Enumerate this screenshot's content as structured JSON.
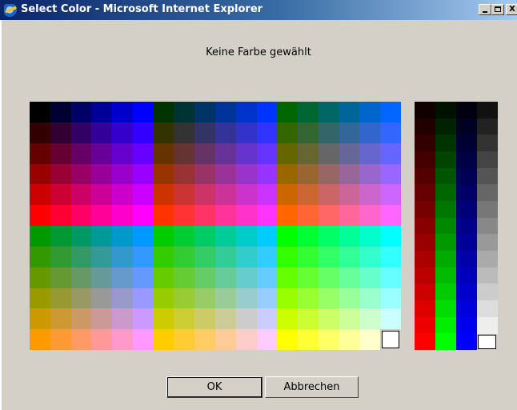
{
  "window": {
    "title": "Select Color - Microsoft Internet Explorer",
    "minimize_icon": "minimize-icon",
    "maximize_icon": "maximize-icon",
    "close_label": "X"
  },
  "status_text": "Keine Farbe gewählt",
  "palette": {
    "selected_color": "#ffffff",
    "rows": [
      [
        "#000000",
        "#000033",
        "#000066",
        "#000099",
        "#0000cc",
        "#0000ff",
        "#003300",
        "#003333",
        "#003366",
        "#003399",
        "#0033cc",
        "#0033ff",
        "#006600",
        "#006633",
        "#006666",
        "#006699",
        "#0066cc",
        "#0066ff"
      ],
      [
        "#330000",
        "#330033",
        "#330066",
        "#330099",
        "#3300cc",
        "#3300ff",
        "#333300",
        "#333333",
        "#333366",
        "#333399",
        "#3333cc",
        "#3333ff",
        "#336600",
        "#336633",
        "#336666",
        "#336699",
        "#3366cc",
        "#3366ff"
      ],
      [
        "#660000",
        "#660033",
        "#660066",
        "#660099",
        "#6600cc",
        "#6600ff",
        "#663300",
        "#663333",
        "#663366",
        "#663399",
        "#6633cc",
        "#6633ff",
        "#666600",
        "#666633",
        "#666666",
        "#666699",
        "#6666cc",
        "#6666ff"
      ],
      [
        "#990000",
        "#990033",
        "#990066",
        "#990099",
        "#9900cc",
        "#9900ff",
        "#993300",
        "#993333",
        "#993366",
        "#993399",
        "#9933cc",
        "#9933ff",
        "#996600",
        "#996633",
        "#996666",
        "#996699",
        "#9966cc",
        "#9966ff"
      ],
      [
        "#cc0000",
        "#cc0033",
        "#cc0066",
        "#cc0099",
        "#cc00cc",
        "#cc00ff",
        "#cc3300",
        "#cc3333",
        "#cc3366",
        "#cc3399",
        "#cc33cc",
        "#cc33ff",
        "#cc6600",
        "#cc6633",
        "#cc6666",
        "#cc6699",
        "#cc66cc",
        "#cc66ff"
      ],
      [
        "#ff0000",
        "#ff0033",
        "#ff0066",
        "#ff0099",
        "#ff00cc",
        "#ff00ff",
        "#ff3300",
        "#ff3333",
        "#ff3366",
        "#ff3399",
        "#ff33cc",
        "#ff33ff",
        "#ff6600",
        "#ff6633",
        "#ff6666",
        "#ff6699",
        "#ff66cc",
        "#ff66ff"
      ],
      [
        "#009900",
        "#009933",
        "#009966",
        "#009999",
        "#0099cc",
        "#0099ff",
        "#00cc00",
        "#00cc33",
        "#00cc66",
        "#00cc99",
        "#00cccc",
        "#00ccff",
        "#00ff00",
        "#00ff33",
        "#00ff66",
        "#00ff99",
        "#00ffcc",
        "#00ffff"
      ],
      [
        "#339900",
        "#339933",
        "#339966",
        "#339999",
        "#3399cc",
        "#3399ff",
        "#33cc00",
        "#33cc33",
        "#33cc66",
        "#33cc99",
        "#33cccc",
        "#33ccff",
        "#33ff00",
        "#33ff33",
        "#33ff66",
        "#33ff99",
        "#33ffcc",
        "#33ffff"
      ],
      [
        "#669900",
        "#669933",
        "#669966",
        "#669999",
        "#6699cc",
        "#6699ff",
        "#66cc00",
        "#66cc33",
        "#66cc66",
        "#66cc99",
        "#66cccc",
        "#66ccff",
        "#66ff00",
        "#66ff33",
        "#66ff66",
        "#66ff99",
        "#66ffcc",
        "#66ffff"
      ],
      [
        "#999900",
        "#999933",
        "#999966",
        "#999999",
        "#9999cc",
        "#9999ff",
        "#99cc00",
        "#99cc33",
        "#99cc66",
        "#99cc99",
        "#99cccc",
        "#99ccff",
        "#99ff00",
        "#99ff33",
        "#99ff66",
        "#99ff99",
        "#99ffcc",
        "#99ffff"
      ],
      [
        "#cc9900",
        "#cc9933",
        "#cc9966",
        "#cc9999",
        "#cc99cc",
        "#cc99ff",
        "#cccc00",
        "#cccc33",
        "#cccc66",
        "#cccc99",
        "#cccccc",
        "#ccccff",
        "#ccff00",
        "#ccff33",
        "#ccff66",
        "#ccff99",
        "#ccffcc",
        "#ccffff"
      ],
      [
        "#ff9900",
        "#ff9933",
        "#ff9966",
        "#ff9999",
        "#ff99cc",
        "#ff99ff",
        "#ffcc00",
        "#ffcc33",
        "#ffcc66",
        "#ffcc99",
        "#ffcccc",
        "#ffccff",
        "#ffff00",
        "#ffff33",
        "#ffff66",
        "#ffff99",
        "#ffffcc",
        "#ffffff"
      ]
    ]
  },
  "side_strips": [
    [
      "#110000",
      "#220000",
      "#330000",
      "#440000",
      "#550000",
      "#660000",
      "#770000",
      "#880000",
      "#990000",
      "#aa0000",
      "#bb0000",
      "#cc0000",
      "#dd0000",
      "#ee0000",
      "#ff0000"
    ],
    [
      "#001100",
      "#002200",
      "#003300",
      "#004400",
      "#005500",
      "#006600",
      "#007700",
      "#008800",
      "#009900",
      "#00aa00",
      "#00bb00",
      "#00cc00",
      "#00dd00",
      "#00ee00",
      "#00ff00"
    ],
    [
      "#000011",
      "#000022",
      "#000033",
      "#000044",
      "#000055",
      "#000066",
      "#000077",
      "#000088",
      "#000099",
      "#0000aa",
      "#0000bb",
      "#0000cc",
      "#0000dd",
      "#0000ee",
      "#0000ff"
    ],
    [
      "#111111",
      "#222222",
      "#333333",
      "#444444",
      "#555555",
      "#666666",
      "#777777",
      "#888888",
      "#999999",
      "#aaaaaa",
      "#bbbbbb",
      "#cccccc",
      "#dddddd",
      "#eeeeee",
      "#ffffff"
    ]
  ],
  "buttons": {
    "ok_label": "OK",
    "cancel_label": "Abbrechen"
  }
}
